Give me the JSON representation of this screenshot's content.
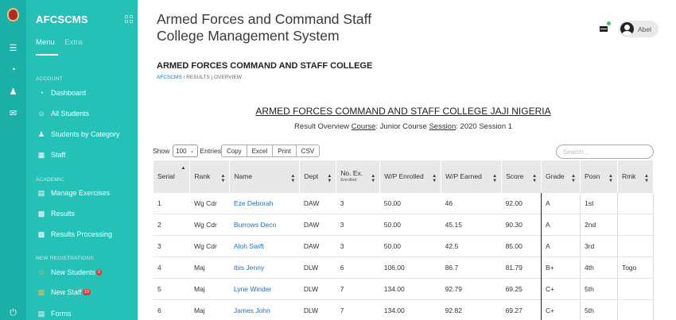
{
  "sidebar": {
    "brand": "AFCSCMS",
    "tabs": [
      "Menu",
      "Extra"
    ],
    "sections": {
      "account": "ACCOUNT",
      "academic": "ACADEMIC",
      "new_registrations": "NEW REGISTRATIONS"
    },
    "items": [
      {
        "label": "Dashboard",
        "icon": "dashboard-icon"
      },
      {
        "label": "All Students",
        "icon": "user-circle-icon"
      },
      {
        "label": "Students by Category",
        "icon": "users-icon"
      },
      {
        "label": "Staff",
        "icon": "id-card-icon"
      },
      {
        "label": "Manage Exercises",
        "icon": "book-icon"
      },
      {
        "label": "Results",
        "icon": "bar-chart-icon"
      },
      {
        "label": "Results Processing",
        "icon": "bar-chart-icon"
      },
      {
        "label": "New Students",
        "icon": "user-circle-icon",
        "badge": "2"
      },
      {
        "label": "New Staff",
        "icon": "id-card-icon",
        "badge": "10"
      },
      {
        "label": "Forms",
        "icon": "form-icon"
      }
    ]
  },
  "header": {
    "title_line1": "Armed Forces and Command Staff",
    "title_line2": "College Management System",
    "user_name": "Abel"
  },
  "page": {
    "heading": "ARMED FORCES COMMAND AND STAFF COLLEGE",
    "breadcrumb_link": "AFCSCMS",
    "breadcrumb_sep": " / ",
    "breadcrumb_rest": "RESULTS | OVERVIEW"
  },
  "report": {
    "title": "ARMED FORCES COMMAND AND STAFF COLLEGE JAJI NIGERIA",
    "sub_prefix": "Result Overview ",
    "course_label": "Course",
    "course_value": ": Junior Course ",
    "session_label": "Session",
    "session_value": ": 2020 Session 1"
  },
  "controls": {
    "show_label": "Show",
    "entries_value": "100",
    "entries_label": "Entries",
    "buttons": [
      "Copy",
      "Excel",
      "Print",
      "CSV"
    ],
    "search_placeholder": "Search..."
  },
  "table": {
    "headers": [
      "Serial",
      "Rank",
      "Name",
      "Dept",
      "No. Ex.",
      "W/P Enrolled",
      "W/P Earned",
      "Score",
      "Grade",
      "Posn",
      "Rmk"
    ],
    "header_sub": "Enrolled",
    "rows": [
      [
        "1",
        "Wg Cdr",
        "Eze Deborah",
        "DAW",
        "3",
        "50.00",
        "46",
        "92.00",
        "A",
        "1st",
        ""
      ],
      [
        "2",
        "Wg Cdr",
        "Burrows Deco",
        "DAW",
        "3",
        "50.00",
        "45.15",
        "90.30",
        "A",
        "2nd",
        ""
      ],
      [
        "3",
        "Wg Cdr",
        "Aloh Swift",
        "DAW",
        "3",
        "50.00",
        "42.5",
        "85.00",
        "A",
        "3rd",
        ""
      ],
      [
        "4",
        "Maj",
        "Ibis Jenny",
        "DLW",
        "6",
        "106.00",
        "86.7",
        "81.79",
        "B+",
        "4th",
        "Togo"
      ],
      [
        "5",
        "Maj",
        "Lyne Winder",
        "DLW",
        "7",
        "134.00",
        "92.79",
        "69.25",
        "C+",
        "5th",
        ""
      ],
      [
        "6",
        "Maj",
        "James John",
        "DLW",
        "7",
        "134.00",
        "92.82",
        "69.27",
        "C+",
        "5th",
        ""
      ]
    ]
  },
  "colors": {
    "sidebar": "#25c0b6",
    "rail": "#1ab0a8",
    "link": "#1a73c6",
    "badge": "#e53935"
  }
}
